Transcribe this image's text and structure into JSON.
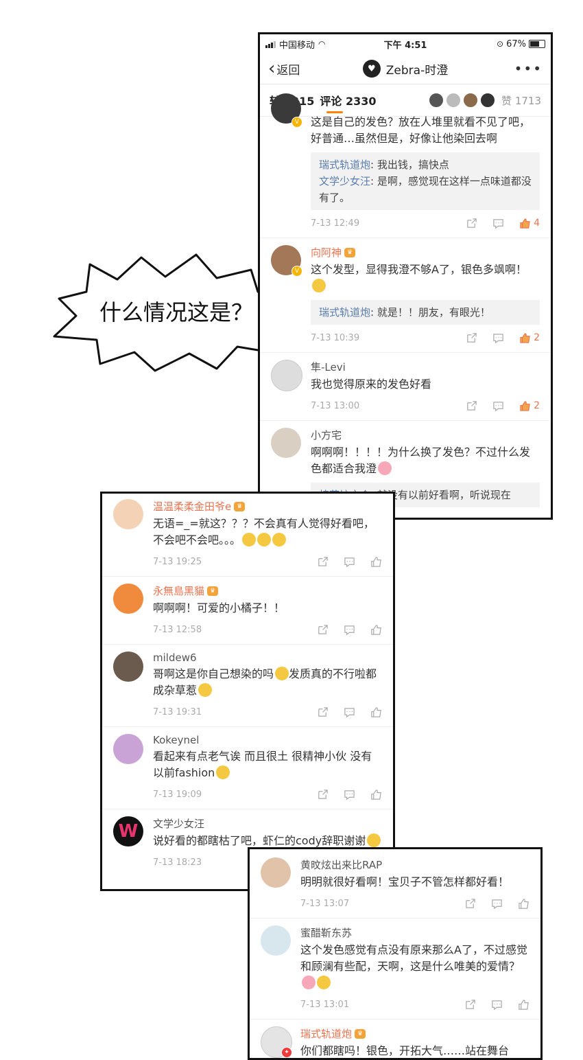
{
  "status_bar": {
    "carrier": "中国移动",
    "time": "下午 4:51",
    "battery": "67%"
  },
  "nav": {
    "back_label": "返回",
    "title": "Zebra-时澄",
    "more": "•••"
  },
  "tabs": {
    "repost": "转发315",
    "comments": "评论 2330",
    "likes": "赞 1713"
  },
  "speech_bubble": "什么情况这是？",
  "phone_comments": [
    {
      "name": "",
      "text": "这是自己的发色？放在人堆里就看不见了吧，好普通…虽然但是，好像让他染回去啊",
      "replies": [
        {
          "name": "瑞式轨道炮",
          "text": ": 我出钱，搞快点"
        },
        {
          "name": "文学少女汪",
          "text": ": 是啊，感觉现在这样一点味道都没有了。"
        }
      ],
      "time": "7-13 12:49",
      "likes": "4"
    },
    {
      "name": "向阿神",
      "text": "这个发型，显得我澄不够A了，银色多飒啊！",
      "replies": [
        {
          "name": "瑞式轨道炮",
          "text": ": 就是！！朋友，有眼光！"
        }
      ],
      "time": "7-13 10:39",
      "likes": "2"
    },
    {
      "name": "隼-Levi",
      "text": "我也觉得原来的发色好看",
      "time": "7-13 13:00",
      "likes": "2"
    },
    {
      "name": "小方宅",
      "text": "啊啊啊！！！！为什么换了发色？不过什么发色都适合我澄",
      "replies": [
        {
          "name": "棉花坨之介",
          "text": ": 就没有以前好看啊，听说现在"
        }
      ]
    }
  ],
  "frame2_comments": [
    {
      "name": "温温柔柔金田爷e",
      "text": "无语=_=就这？？？不会真有人觉得好看吧，不会吧不会吧。。。",
      "time": "7-13 19:25"
    },
    {
      "name": "永無島黑貓",
      "text": "啊啊啊！可爱的小橘子！！",
      "time": "7-13 12:58"
    },
    {
      "name": "mildew6",
      "text": "哥啊这是你自己想染的吗",
      "text2": "发质真的不行啦都成杂草惹",
      "time": "7-13 19:31"
    },
    {
      "name": "Kokeynel",
      "text": "看起来有点老气诶 而且很土 很精神小伙 没有以前fashion",
      "time": "7-13 19:09"
    },
    {
      "name": "文学少女汪",
      "text": "说好看的都瞎枯了吧，虾仁的cody辞职谢谢",
      "time": "7-13 18:23"
    }
  ],
  "frame3_comments": [
    {
      "name": "黄旼炫出来比RAP",
      "text": "明明就很好看啊！宝贝子不管怎样都好看！",
      "time": "7-13 13:07"
    },
    {
      "name": "蜜醋靳东苏",
      "text": "这个发色感觉有点没有原来那么A了，不过感觉和顾澜有些配，天啊，这是什么唯美的爱情？",
      "time": "7-13 13:01"
    },
    {
      "name": "瑞式轨道炮",
      "text": "你们都瞎吗！银色，开拓大气……站在舞台"
    }
  ],
  "colors": {
    "accent": "#ff8200",
    "username_orange": "#eb7350",
    "reply_name_blue": "#5b7eaf"
  }
}
